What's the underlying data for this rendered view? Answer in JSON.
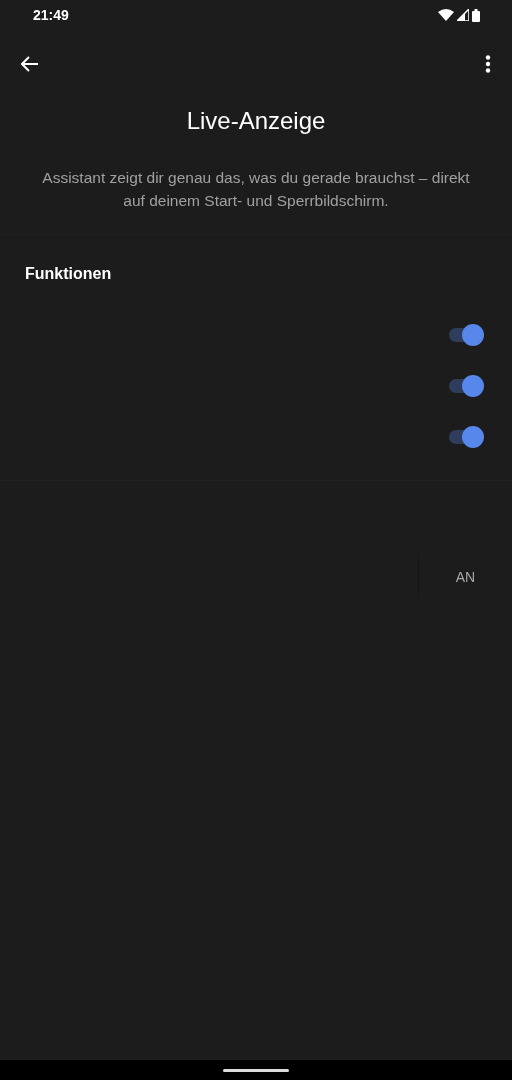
{
  "status_bar": {
    "time": "21:49"
  },
  "title": "Live-Anzeige",
  "description": "Assistant zeigt dir genau das, was du gerade brauchst – direkt auf deinem Start- und Sperrbildschirm.",
  "section": {
    "title": "Funktionen",
    "toggles": [
      {
        "on": true
      },
      {
        "on": true
      },
      {
        "on": true
      }
    ]
  },
  "action": {
    "label": "AN"
  }
}
